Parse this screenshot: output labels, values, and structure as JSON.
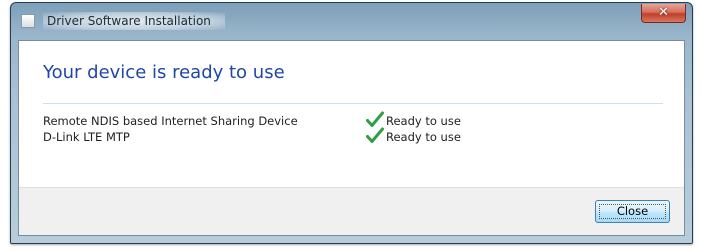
{
  "window": {
    "title": "Driver Software Installation",
    "close_glyph": "✕"
  },
  "content": {
    "heading": "Your device is ready to use",
    "devices": [
      {
        "name": "Remote NDIS based Internet Sharing Device",
        "status": "Ready to use",
        "status_icon": "check-icon"
      },
      {
        "name": "D-Link LTE MTP",
        "status": "Ready to use",
        "status_icon": "check-icon"
      }
    ]
  },
  "footer": {
    "close_label": "Close"
  },
  "colors": {
    "heading": "#1f46a8",
    "check": "#2ea043",
    "close_button_border": "#3c7fb1",
    "titlebar_close": "#c0402c"
  }
}
